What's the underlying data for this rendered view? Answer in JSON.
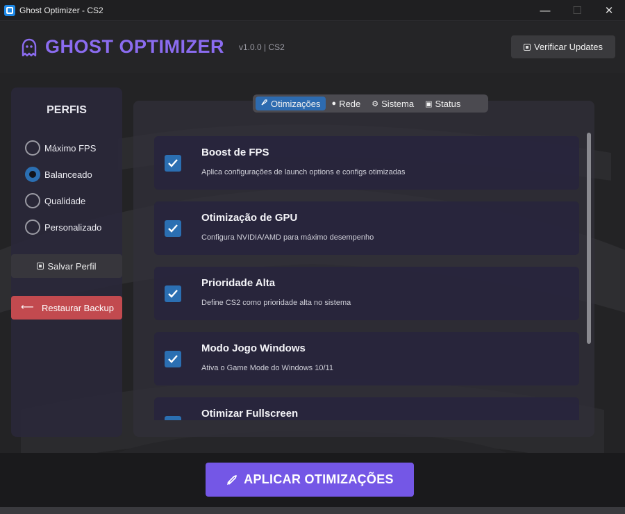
{
  "window": {
    "title": "Ghost Optimizer - CS2",
    "minimize": "—",
    "maximize": "☐",
    "close": "✕"
  },
  "header": {
    "brand": "GHOST OPTIMIZER",
    "version": "v1.0.0 | CS2",
    "update_button": "Verificar Updates",
    "brand_color": "#8b6cf0"
  },
  "sidebar": {
    "title": "PERFIS",
    "profiles": [
      {
        "label": "Máximo FPS",
        "checked": false
      },
      {
        "label": "Balanceado",
        "checked": true
      },
      {
        "label": "Qualidade",
        "checked": false
      },
      {
        "label": "Personalizado",
        "checked": false
      }
    ],
    "save_button": "Salvar Perfil",
    "restore_button": "Restaurar Backup",
    "restore_arrow": "⟵"
  },
  "tabs": [
    {
      "label": "Otimizações",
      "icon": "rocket-icon",
      "glyph": "🚀",
      "active": true
    },
    {
      "label": "Rede",
      "icon": "globe-icon",
      "glyph": "●",
      "active": false
    },
    {
      "label": "Sistema",
      "icon": "gear-icon",
      "glyph": "⚙",
      "active": false
    },
    {
      "label": "Status",
      "icon": "chart-icon",
      "glyph": "▣",
      "active": false
    }
  ],
  "optimizations": [
    {
      "title": "Boost de FPS",
      "description": "Aplica configurações de launch options e configs otimizadas",
      "checked": true
    },
    {
      "title": "Otimização de GPU",
      "description": "Configura NVIDIA/AMD para máximo desempenho",
      "checked": true
    },
    {
      "title": "Prioridade Alta",
      "description": "Define CS2 como prioridade alta no sistema",
      "checked": true
    },
    {
      "title": "Modo Jogo Windows",
      "description": "Ativa o Game Mode do Windows 10/11",
      "checked": true
    },
    {
      "title": "Otimizar Fullscreen",
      "description": "",
      "checked": true
    }
  ],
  "footer": {
    "apply_button": "APLICAR OTIMIZAÇÕES",
    "apply_color": "#7457e6"
  }
}
